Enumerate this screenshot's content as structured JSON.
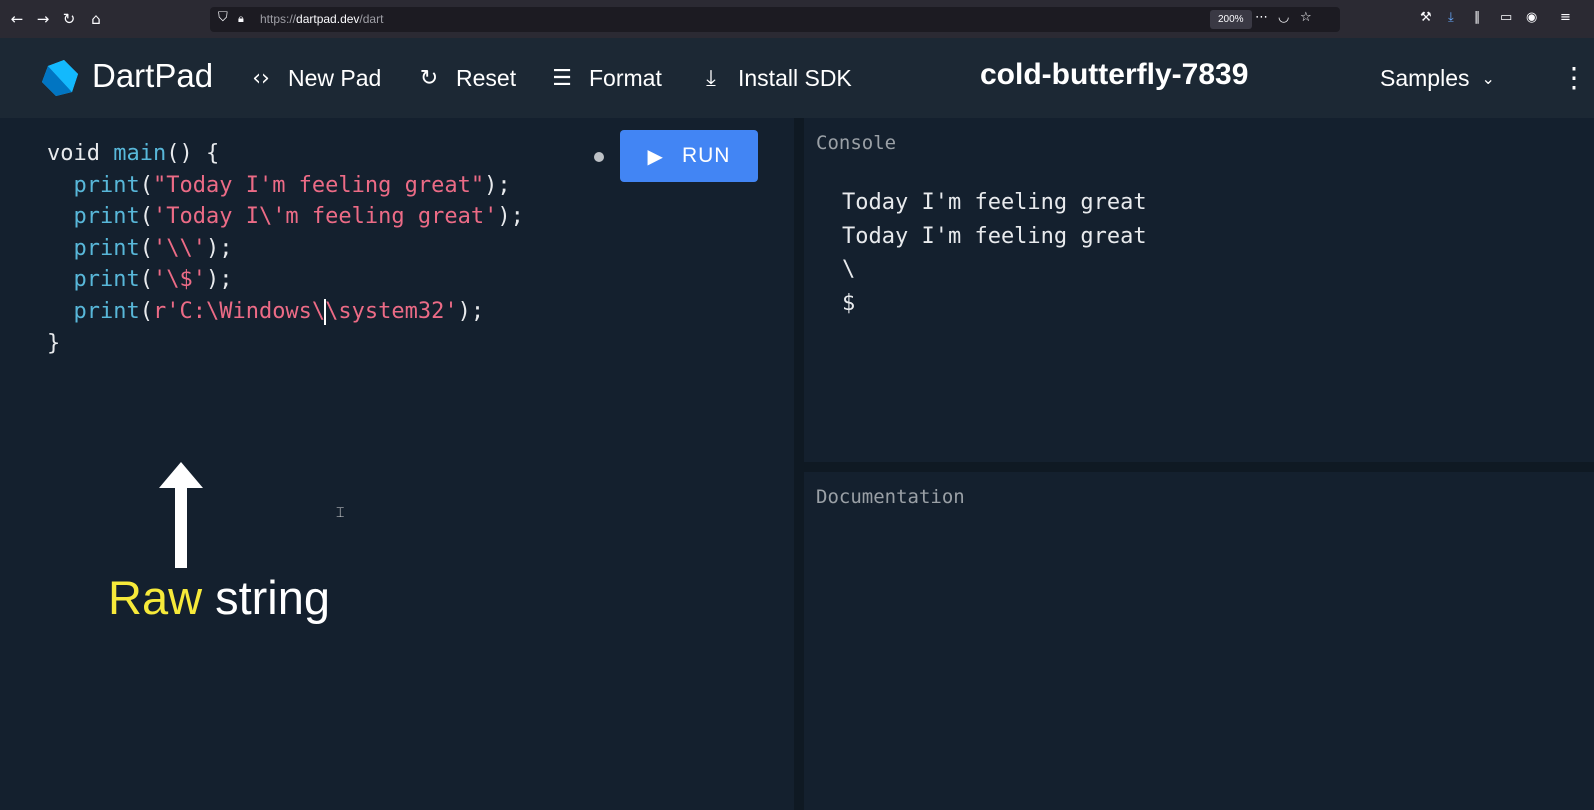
{
  "browser": {
    "url_scheme": "https://",
    "url_host": "dartpad.dev",
    "url_path": "/dart",
    "zoom": "200%"
  },
  "header": {
    "app_title": "DartPad",
    "new_pad_label": "New Pad",
    "reset_label": "Reset",
    "format_label": "Format",
    "install_sdk_label": "Install SDK",
    "pad_name": "cold-butterfly-7839",
    "samples_label": "Samples"
  },
  "editor": {
    "run_label": "RUN",
    "lines": [
      "void main() {",
      "  print(\"Today I'm feeling great\");",
      "  print('Today I\\'m feeling great');",
      "  print('\\\\');",
      "  print('\\$');",
      "  print(r'C:\\Windows\\system32');",
      "}"
    ]
  },
  "annotation": {
    "word1": "Raw",
    "word2": "string"
  },
  "console": {
    "title": "Console",
    "output": [
      "Today I'm feeling great",
      "Today I'm feeling great",
      "\\",
      "$"
    ]
  },
  "documentation": {
    "title": "Documentation"
  },
  "colors": {
    "header_bg": "#1c2834",
    "pane_bg": "#14202e",
    "run_button": "#4285f4",
    "string": "#ec6b86",
    "function": "#58b7d9",
    "annotation_highlight": "#f7ea3a"
  },
  "icons": {
    "new_pad": "code-brackets-icon",
    "reset": "refresh-icon",
    "format": "align-left-icon",
    "install_sdk": "download-icon",
    "samples": "chevron-down-icon",
    "more": "more-vert-icon",
    "run": "play-icon"
  }
}
